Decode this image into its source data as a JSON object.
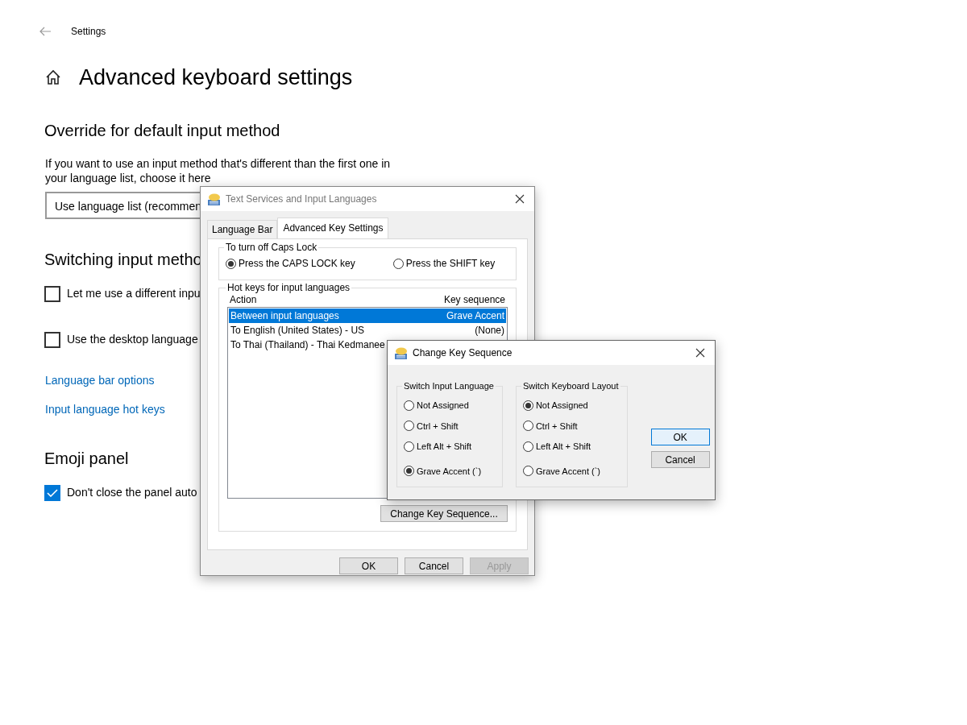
{
  "header": {
    "app_title": "Settings"
  },
  "page_title": "Advanced keyboard settings",
  "sections": [
    {
      "heading": "Override for default input method",
      "items": [
        {
          "kind": "text",
          "text": "If you want to use an input method that's different than the first one in your language list, choose it here"
        },
        {
          "kind": "dropdown",
          "value": "Use language list (recommen"
        }
      ]
    },
    {
      "heading": "Switching input metho",
      "items": [
        {
          "kind": "checkbox",
          "label": "Let me use a different inpu",
          "checked": false
        },
        {
          "kind": "checkbox",
          "label": "Use the desktop language",
          "checked": false
        },
        {
          "kind": "link",
          "text": "Language bar options"
        },
        {
          "kind": "link",
          "text": "Input language hot keys"
        }
      ]
    },
    {
      "heading": "Emoji panel",
      "items": [
        {
          "kind": "checkbox",
          "label": "Don't close the panel auto",
          "checked": true
        }
      ]
    }
  ],
  "text_services_dialog": {
    "title": "Text Services and Input Languages",
    "tabs": [
      {
        "label": "Language Bar",
        "selected": false
      },
      {
        "label": "Advanced Key Settings",
        "selected": true
      }
    ],
    "caps_lock": {
      "legend": "To turn off Caps Lock",
      "options": [
        {
          "label": "Press the CAPS LOCK key",
          "selected": true
        },
        {
          "label": "Press the SHIFT key",
          "selected": false
        }
      ]
    },
    "hot_keys": {
      "legend": "Hot keys for input languages",
      "columns": [
        "Action",
        "Key sequence"
      ],
      "rows": [
        {
          "action": "Between input languages",
          "key_sequence": "Grave Accent",
          "selected": true
        },
        {
          "action": "To English (United States) - US",
          "key_sequence": "(None)",
          "selected": false
        },
        {
          "action": "To Thai (Thailand) - Thai Kedmanee",
          "selected": false
        }
      ],
      "button": "Change Key Sequence..."
    },
    "buttons": [
      {
        "label": "OK",
        "disabled": false
      },
      {
        "label": "Cancel",
        "disabled": false
      },
      {
        "label": "Apply",
        "disabled": true
      }
    ]
  },
  "change_key_dialog": {
    "title": "Change Key Sequence",
    "groups": [
      {
        "legend": "Switch Input Language",
        "options": [
          {
            "label": "Not Assigned",
            "selected": false
          },
          {
            "label": "Ctrl + Shift",
            "selected": false
          },
          {
            "label": "Left Alt + Shift",
            "selected": false
          },
          {
            "label": "Grave Accent (`)",
            "selected": true
          }
        ]
      },
      {
        "legend": "Switch Keyboard Layout",
        "options": [
          {
            "label": "Not Assigned",
            "selected": true
          },
          {
            "label": "Ctrl + Shift",
            "selected": false
          },
          {
            "label": "Left Alt + Shift",
            "selected": false
          },
          {
            "label": "Grave Accent (`)",
            "selected": false
          }
        ]
      }
    ],
    "buttons": [
      {
        "label": "OK",
        "default": true
      },
      {
        "label": "Cancel",
        "default": false
      }
    ]
  }
}
